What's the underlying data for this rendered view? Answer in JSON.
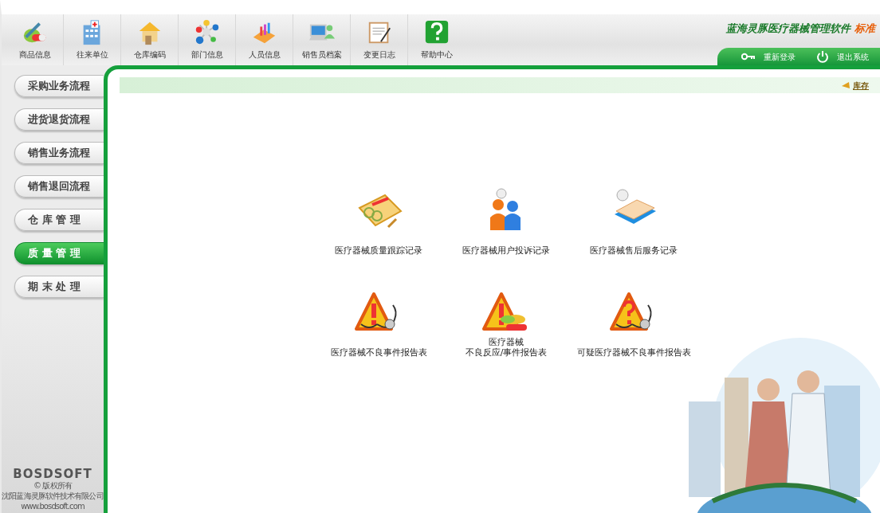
{
  "toolbar": [
    {
      "label": "商品信息"
    },
    {
      "label": "往来单位"
    },
    {
      "label": "仓库编码"
    },
    {
      "label": "部门信息"
    },
    {
      "label": "人员信息"
    },
    {
      "label": "销售员档案"
    },
    {
      "label": "变更日志"
    },
    {
      "label": "帮助中心"
    }
  ],
  "header": {
    "title": "蓝海灵豚医疗器械管理软件",
    "edition": "标准",
    "actions": [
      {
        "label": "重新登录",
        "kind": "key"
      },
      {
        "label": "退出系统",
        "kind": "power"
      }
    ]
  },
  "sidebar": {
    "items": [
      {
        "label": "采购业务流程",
        "selected": false
      },
      {
        "label": "进货退货流程",
        "selected": false
      },
      {
        "label": "销售业务流程",
        "selected": false
      },
      {
        "label": "销售退回流程",
        "selected": false
      },
      {
        "label": "仓 库 管 理",
        "selected": false
      },
      {
        "label": "质 量 管 理",
        "selected": true
      },
      {
        "label": "期 末 处 理",
        "selected": false
      }
    ],
    "footer": {
      "logo": "BOSDSOFT",
      "copyright": "© 版权所有",
      "company": "沈阳蓝海灵豚软件技术有限公司",
      "website": "www.bosdsoft.com"
    }
  },
  "main": {
    "link": "库存",
    "modules": [
      {
        "lines": [
          "医疗器械质量跟踪记录"
        ],
        "kind": "glasses"
      },
      {
        "lines": [
          "医疗器械用户投诉记录"
        ],
        "kind": "people"
      },
      {
        "lines": [
          "医疗器械售后服务记录"
        ],
        "kind": "notebook"
      },
      {
        "lines": [
          "医疗器械不良事件报告表"
        ],
        "kind": "warning-stethoscope"
      },
      {
        "lines": [
          "医疗器械",
          "不良反应/事件报告表"
        ],
        "kind": "warning-pills"
      },
      {
        "lines": [
          "可疑医疗器械不良事件报告表"
        ],
        "kind": "question-stethoscope"
      }
    ]
  }
}
